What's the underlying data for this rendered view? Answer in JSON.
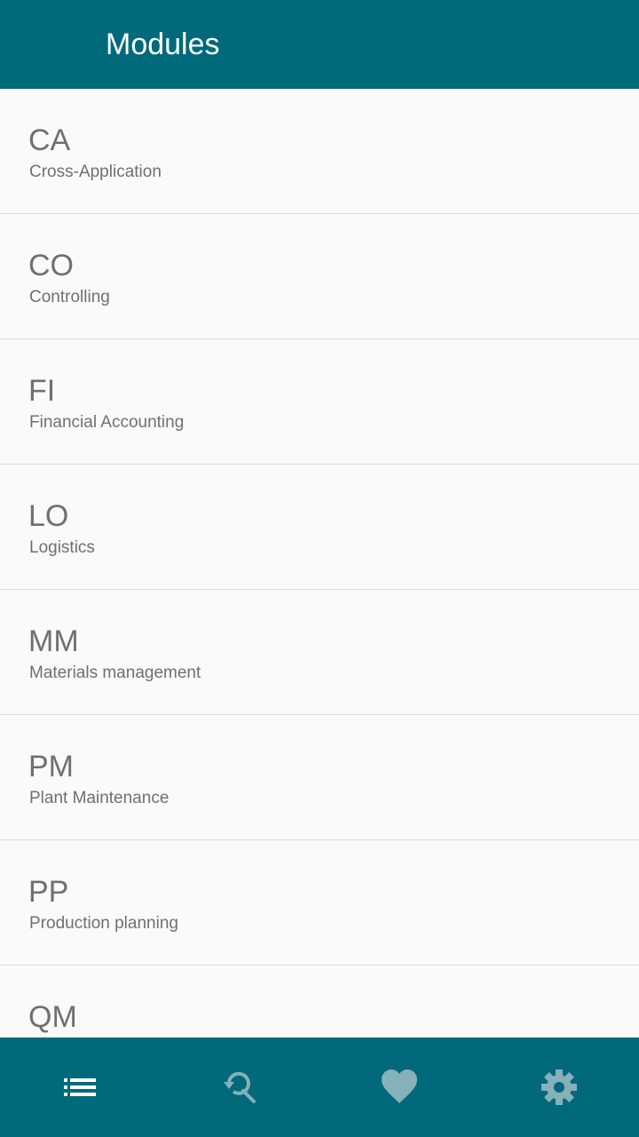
{
  "appbar": {
    "title": "Modules"
  },
  "modules": [
    {
      "code": "CA",
      "name": "Cross-Application"
    },
    {
      "code": "CO",
      "name": "Controlling"
    },
    {
      "code": "FI",
      "name": "Financial Accounting"
    },
    {
      "code": "LO",
      "name": "Logistics"
    },
    {
      "code": "MM",
      "name": "Materials management"
    },
    {
      "code": "PM",
      "name": "Plant Maintenance"
    },
    {
      "code": "PP",
      "name": "Production planning"
    },
    {
      "code": "QM",
      "name": ""
    }
  ],
  "bottom_nav": [
    {
      "id": "modules",
      "icon": "list-icon",
      "active": true
    },
    {
      "id": "search-history",
      "icon": "search-history-icon",
      "active": false
    },
    {
      "id": "favorites",
      "icon": "heart-icon",
      "active": false
    },
    {
      "id": "settings",
      "icon": "gear-icon",
      "active": false
    }
  ],
  "colors": {
    "primary": "#006a7a",
    "icon_active": "#ffffff",
    "icon_inactive": "#86b0ba",
    "text_secondary": "#707070"
  }
}
